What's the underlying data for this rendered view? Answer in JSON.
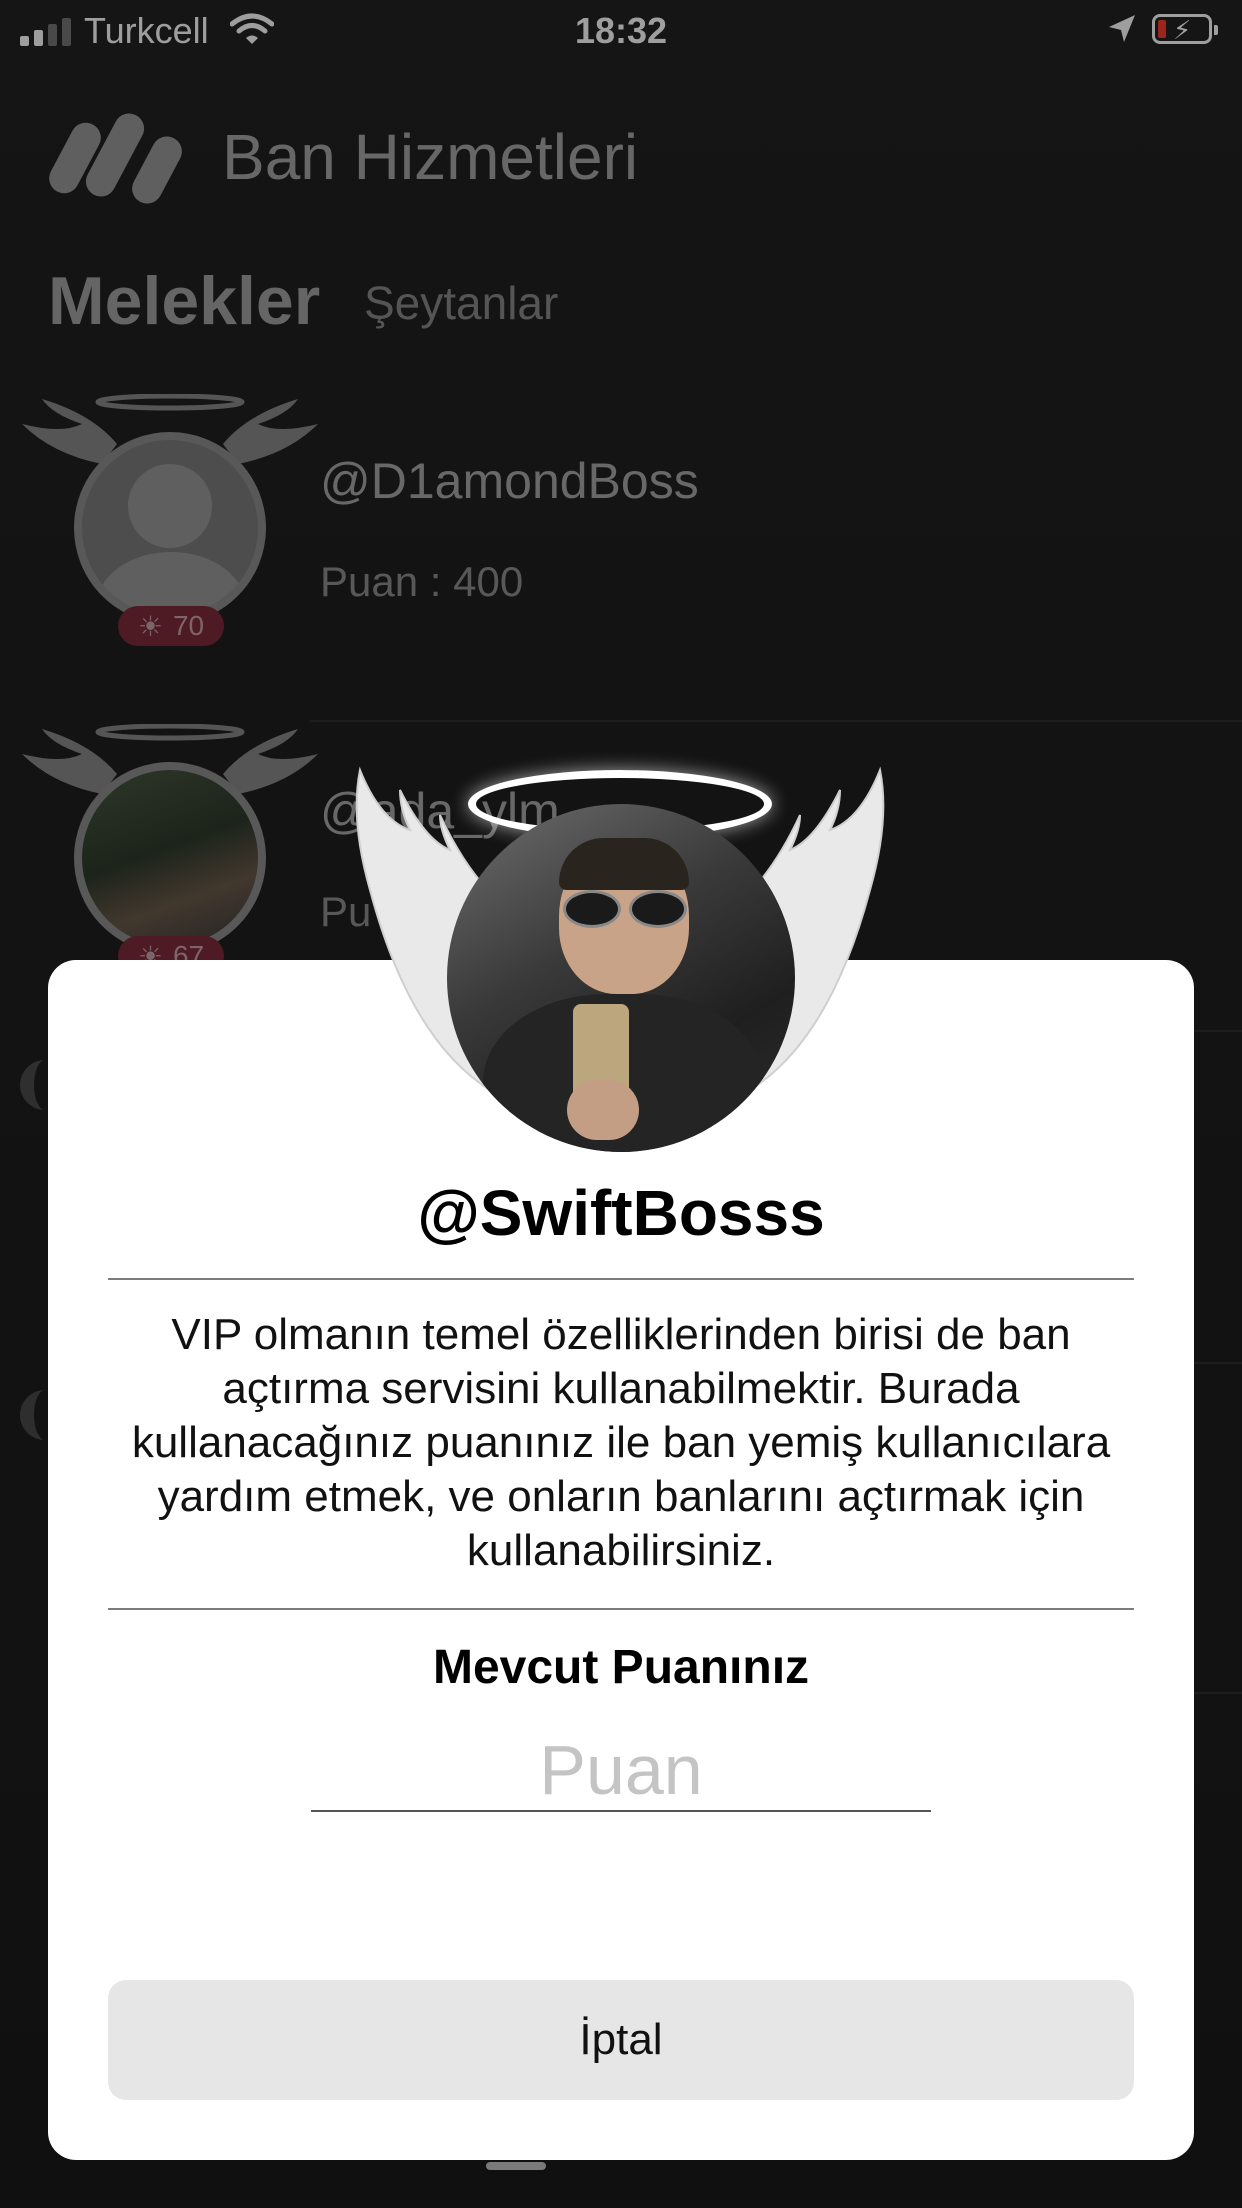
{
  "status_bar": {
    "carrier": "Turkcell",
    "time": "18:32"
  },
  "header": {
    "app_title": "Ban Hizmetleri",
    "segments": [
      "Melekler",
      "Şeytanlar"
    ]
  },
  "list": [
    {
      "username": "@D1amondBoss",
      "points": "Puan : 400",
      "badge": "70"
    },
    {
      "username": "@ada_ylm",
      "points": "Pu",
      "badge": "67"
    }
  ],
  "modal": {
    "username": "@SwiftBosss",
    "description": "VIP olmanın temel özelliklerinden birisi de ban açtırma servisini kullanabilmektir. Burada kullanacağınız puanınız ile ban yemiş kullanıcılara yardım etmek, ve onların banlarını açtırmak için kullanabilirsiniz.",
    "points_label": "Mevcut Puanınız",
    "points_placeholder": "Puan",
    "cancel_label": "İptal"
  },
  "colors": {
    "badge_bg": "#7e2b3b",
    "battery_low": "#ff3b30"
  }
}
